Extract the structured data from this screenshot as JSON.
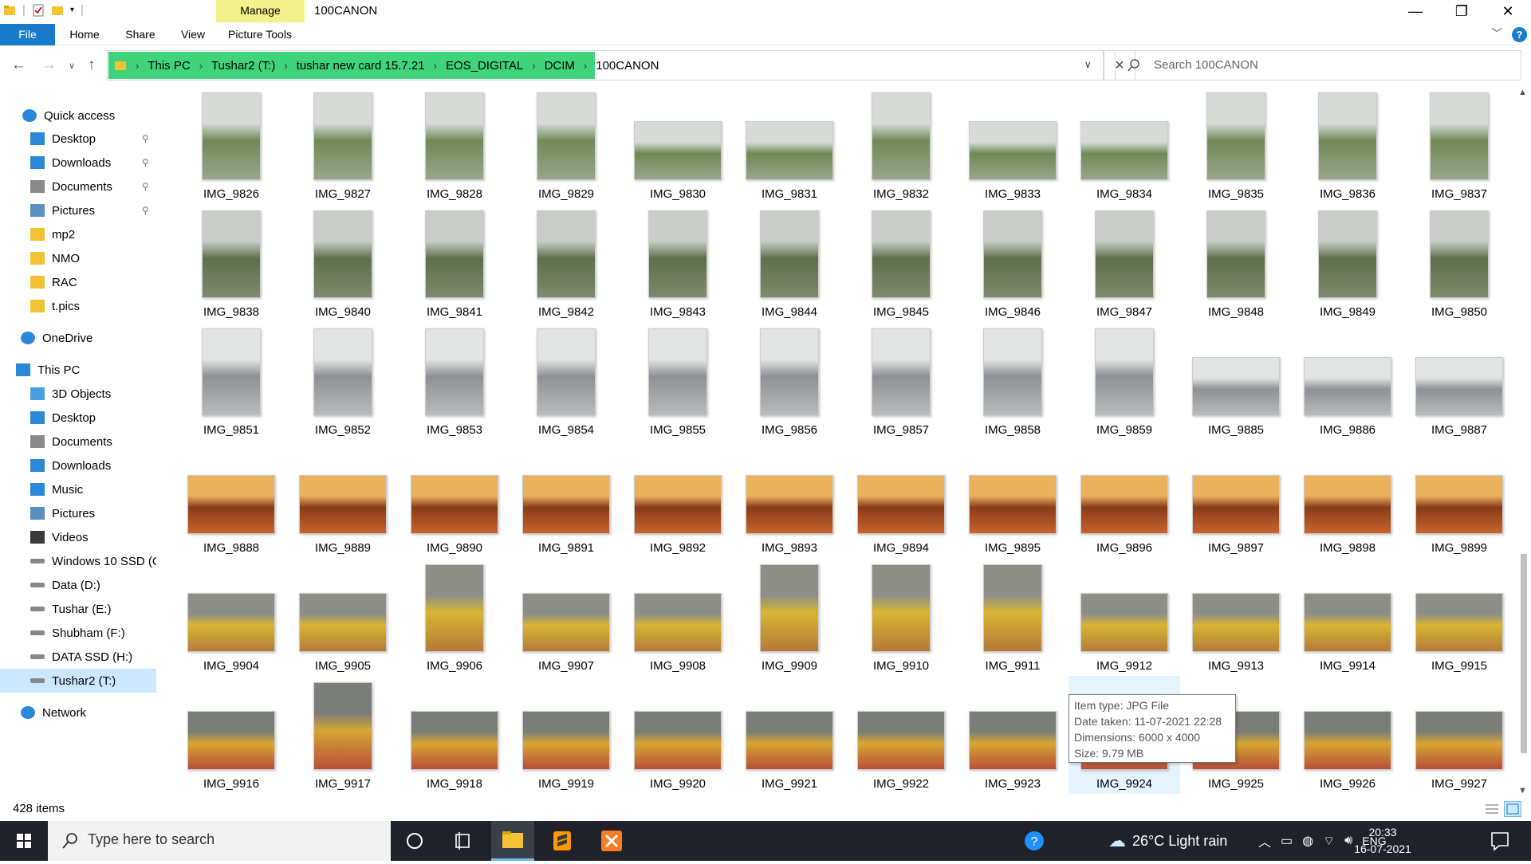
{
  "window": {
    "title": "100CANON",
    "manage_tab": "Manage",
    "picture_tools": "Picture Tools"
  },
  "ribbon": {
    "tabs": [
      "File",
      "Home",
      "Share",
      "View",
      "Picture Tools"
    ]
  },
  "breadcrumb": [
    "This PC",
    "Tushar2 (T:)",
    "tushar new card 15.7.21",
    "EOS_DIGITAL",
    "DCIM",
    "100CANON"
  ],
  "search": {
    "placeholder": "Search 100CANON"
  },
  "nav": [
    {
      "label": "Quick access",
      "icon": "star-icon",
      "pinned": false
    },
    {
      "label": "Desktop",
      "icon": "desktop-icon",
      "pinned": true
    },
    {
      "label": "Downloads",
      "icon": "download-icon",
      "pinned": true
    },
    {
      "label": "Documents",
      "icon": "documents-icon",
      "pinned": true
    },
    {
      "label": "Pictures",
      "icon": "pictures-icon",
      "pinned": true
    },
    {
      "label": "mp2",
      "icon": "folder-icon",
      "pinned": false
    },
    {
      "label": "NMO",
      "icon": "folder-icon",
      "pinned": false
    },
    {
      "label": "RAC",
      "icon": "folder-icon",
      "pinned": false
    },
    {
      "label": "t.pics",
      "icon": "folder-icon",
      "pinned": false
    },
    {
      "label": "OneDrive",
      "icon": "cloud-icon",
      "pinned": false
    },
    {
      "label": "This PC",
      "icon": "computer-icon",
      "pinned": false
    },
    {
      "label": "3D Objects",
      "icon": "cube-icon",
      "pinned": false
    },
    {
      "label": "Desktop",
      "icon": "desktop-icon",
      "pinned": false
    },
    {
      "label": "Documents",
      "icon": "documents-icon",
      "pinned": false
    },
    {
      "label": "Downloads",
      "icon": "download-icon",
      "pinned": false
    },
    {
      "label": "Music",
      "icon": "music-icon",
      "pinned": false
    },
    {
      "label": "Pictures",
      "icon": "pictures-icon",
      "pinned": false
    },
    {
      "label": "Videos",
      "icon": "videos-icon",
      "pinned": false
    },
    {
      "label": "Windows 10 SSD (C",
      "icon": "drive-icon",
      "pinned": false
    },
    {
      "label": "Data (D:)",
      "icon": "drive-icon",
      "pinned": false
    },
    {
      "label": "Tushar (E:)",
      "icon": "drive-icon",
      "pinned": false
    },
    {
      "label": "Shubham (F:)",
      "icon": "drive-icon",
      "pinned": false
    },
    {
      "label": "DATA SSD (H:)",
      "icon": "drive-icon",
      "pinned": false
    },
    {
      "label": "Tushar2 (T:)",
      "icon": "drive-icon",
      "pinned": false,
      "selected": true
    },
    {
      "label": "Network",
      "icon": "network-icon",
      "pinned": false
    }
  ],
  "files": [
    [
      "IMG_9826",
      "IMG_9827",
      "IMG_9828",
      "IMG_9829",
      "IMG_9830",
      "IMG_9831",
      "IMG_9832",
      "IMG_9833",
      "IMG_9834",
      "IMG_9835",
      "IMG_9836",
      "IMG_9837"
    ],
    [
      "IMG_9838",
      "IMG_9840",
      "IMG_9841",
      "IMG_9842",
      "IMG_9843",
      "IMG_9844",
      "IMG_9845",
      "IMG_9846",
      "IMG_9847",
      "IMG_9848",
      "IMG_9849",
      "IMG_9850"
    ],
    [
      "IMG_9851",
      "IMG_9852",
      "IMG_9853",
      "IMG_9854",
      "IMG_9855",
      "IMG_9856",
      "IMG_9857",
      "IMG_9858",
      "IMG_9859",
      "IMG_9885",
      "IMG_9886",
      "IMG_9887"
    ],
    [
      "IMG_9888",
      "IMG_9889",
      "IMG_9890",
      "IMG_9891",
      "IMG_9892",
      "IMG_9893",
      "IMG_9894",
      "IMG_9895",
      "IMG_9896",
      "IMG_9897",
      "IMG_9898",
      "IMG_9899"
    ],
    [
      "IMG_9904",
      "IMG_9905",
      "IMG_9906",
      "IMG_9907",
      "IMG_9908",
      "IMG_9909",
      "IMG_9910",
      "IMG_9911",
      "IMG_9912",
      "IMG_9913",
      "IMG_9914",
      "IMG_9915"
    ],
    [
      "IMG_9916",
      "IMG_9917",
      "IMG_9918",
      "IMG_9919",
      "IMG_9920",
      "IMG_9921",
      "IMG_9922",
      "IMG_9923",
      "IMG_9924",
      "IMG_9925",
      "IMG_9926",
      "IMG_9927"
    ]
  ],
  "tooltip": {
    "type": "Item type: JPG File",
    "date": "Date taken: 11-07-2021 22:28",
    "dims": "Dimensions: 6000 x 4000",
    "size": "Size: 9.79 MB"
  },
  "status": {
    "count": "428 items"
  },
  "taskbar": {
    "search_placeholder": "Type here to search",
    "weather": "26°C  Light rain",
    "lang": "ENG",
    "time": "20:33",
    "date": "16-07-2021"
  }
}
